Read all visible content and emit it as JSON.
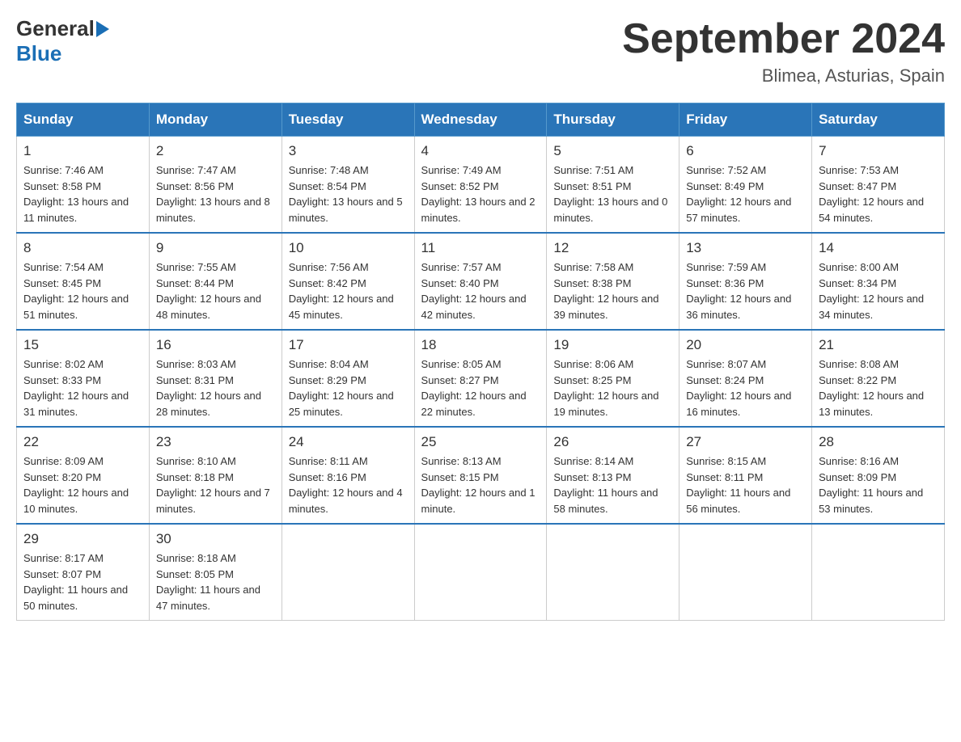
{
  "header": {
    "logo": {
      "general": "General",
      "blue": "Blue"
    },
    "title": "September 2024",
    "location": "Blimea, Asturias, Spain"
  },
  "days_of_week": [
    "Sunday",
    "Monday",
    "Tuesday",
    "Wednesday",
    "Thursday",
    "Friday",
    "Saturday"
  ],
  "weeks": [
    [
      {
        "day": "1",
        "sunrise": "7:46 AM",
        "sunset": "8:58 PM",
        "daylight": "13 hours and 11 minutes."
      },
      {
        "day": "2",
        "sunrise": "7:47 AM",
        "sunset": "8:56 PM",
        "daylight": "13 hours and 8 minutes."
      },
      {
        "day": "3",
        "sunrise": "7:48 AM",
        "sunset": "8:54 PM",
        "daylight": "13 hours and 5 minutes."
      },
      {
        "day": "4",
        "sunrise": "7:49 AM",
        "sunset": "8:52 PM",
        "daylight": "13 hours and 2 minutes."
      },
      {
        "day": "5",
        "sunrise": "7:51 AM",
        "sunset": "8:51 PM",
        "daylight": "13 hours and 0 minutes."
      },
      {
        "day": "6",
        "sunrise": "7:52 AM",
        "sunset": "8:49 PM",
        "daylight": "12 hours and 57 minutes."
      },
      {
        "day": "7",
        "sunrise": "7:53 AM",
        "sunset": "8:47 PM",
        "daylight": "12 hours and 54 minutes."
      }
    ],
    [
      {
        "day": "8",
        "sunrise": "7:54 AM",
        "sunset": "8:45 PM",
        "daylight": "12 hours and 51 minutes."
      },
      {
        "day": "9",
        "sunrise": "7:55 AM",
        "sunset": "8:44 PM",
        "daylight": "12 hours and 48 minutes."
      },
      {
        "day": "10",
        "sunrise": "7:56 AM",
        "sunset": "8:42 PM",
        "daylight": "12 hours and 45 minutes."
      },
      {
        "day": "11",
        "sunrise": "7:57 AM",
        "sunset": "8:40 PM",
        "daylight": "12 hours and 42 minutes."
      },
      {
        "day": "12",
        "sunrise": "7:58 AM",
        "sunset": "8:38 PM",
        "daylight": "12 hours and 39 minutes."
      },
      {
        "day": "13",
        "sunrise": "7:59 AM",
        "sunset": "8:36 PM",
        "daylight": "12 hours and 36 minutes."
      },
      {
        "day": "14",
        "sunrise": "8:00 AM",
        "sunset": "8:34 PM",
        "daylight": "12 hours and 34 minutes."
      }
    ],
    [
      {
        "day": "15",
        "sunrise": "8:02 AM",
        "sunset": "8:33 PM",
        "daylight": "12 hours and 31 minutes."
      },
      {
        "day": "16",
        "sunrise": "8:03 AM",
        "sunset": "8:31 PM",
        "daylight": "12 hours and 28 minutes."
      },
      {
        "day": "17",
        "sunrise": "8:04 AM",
        "sunset": "8:29 PM",
        "daylight": "12 hours and 25 minutes."
      },
      {
        "day": "18",
        "sunrise": "8:05 AM",
        "sunset": "8:27 PM",
        "daylight": "12 hours and 22 minutes."
      },
      {
        "day": "19",
        "sunrise": "8:06 AM",
        "sunset": "8:25 PM",
        "daylight": "12 hours and 19 minutes."
      },
      {
        "day": "20",
        "sunrise": "8:07 AM",
        "sunset": "8:24 PM",
        "daylight": "12 hours and 16 minutes."
      },
      {
        "day": "21",
        "sunrise": "8:08 AM",
        "sunset": "8:22 PM",
        "daylight": "12 hours and 13 minutes."
      }
    ],
    [
      {
        "day": "22",
        "sunrise": "8:09 AM",
        "sunset": "8:20 PM",
        "daylight": "12 hours and 10 minutes."
      },
      {
        "day": "23",
        "sunrise": "8:10 AM",
        "sunset": "8:18 PM",
        "daylight": "12 hours and 7 minutes."
      },
      {
        "day": "24",
        "sunrise": "8:11 AM",
        "sunset": "8:16 PM",
        "daylight": "12 hours and 4 minutes."
      },
      {
        "day": "25",
        "sunrise": "8:13 AM",
        "sunset": "8:15 PM",
        "daylight": "12 hours and 1 minute."
      },
      {
        "day": "26",
        "sunrise": "8:14 AM",
        "sunset": "8:13 PM",
        "daylight": "11 hours and 58 minutes."
      },
      {
        "day": "27",
        "sunrise": "8:15 AM",
        "sunset": "8:11 PM",
        "daylight": "11 hours and 56 minutes."
      },
      {
        "day": "28",
        "sunrise": "8:16 AM",
        "sunset": "8:09 PM",
        "daylight": "11 hours and 53 minutes."
      }
    ],
    [
      {
        "day": "29",
        "sunrise": "8:17 AM",
        "sunset": "8:07 PM",
        "daylight": "11 hours and 50 minutes."
      },
      {
        "day": "30",
        "sunrise": "8:18 AM",
        "sunset": "8:05 PM",
        "daylight": "11 hours and 47 minutes."
      },
      null,
      null,
      null,
      null,
      null
    ]
  ]
}
